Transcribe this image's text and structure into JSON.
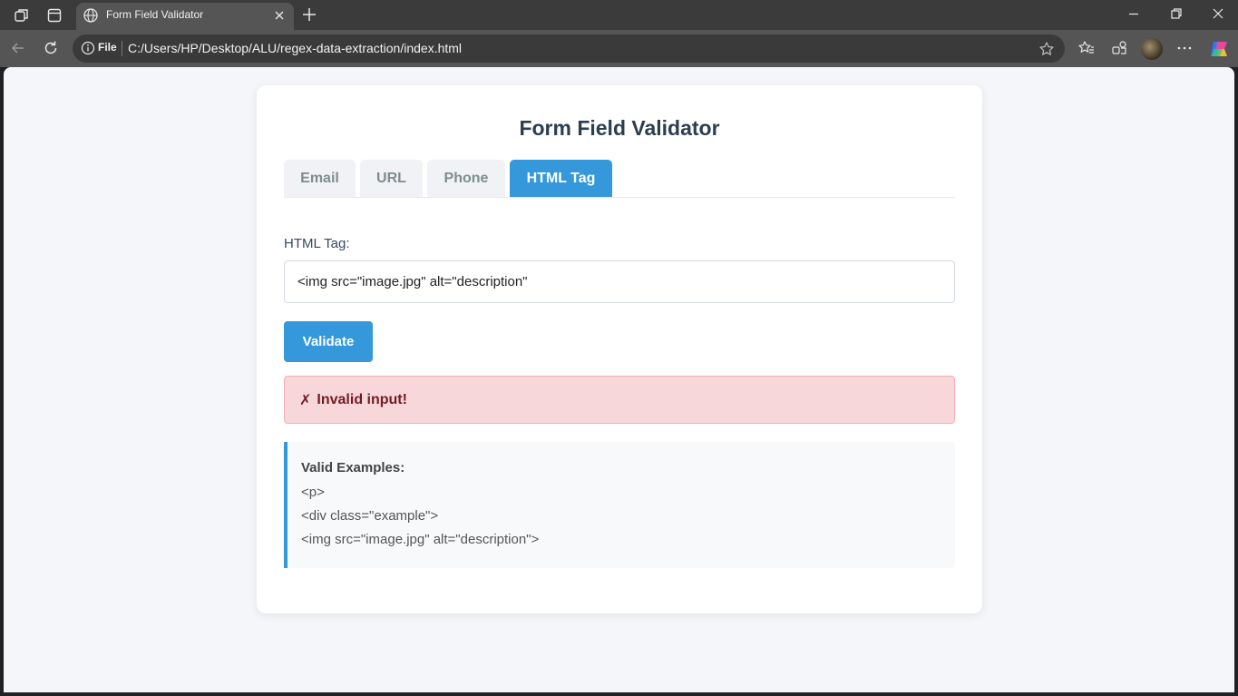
{
  "browser": {
    "tab_title": "Form Field Validator",
    "address_scheme_label": "File",
    "address_url": "C:/Users/HP/Desktop/ALU/regex-data-extraction/index.html"
  },
  "page": {
    "title": "Form Field Validator",
    "tabs": [
      {
        "label": "Email",
        "active": false
      },
      {
        "label": "URL",
        "active": false
      },
      {
        "label": "Phone",
        "active": false
      },
      {
        "label": "HTML Tag",
        "active": true
      }
    ],
    "field_label": "HTML Tag:",
    "field_value": "<img src=\"image.jpg\" alt=\"description\"",
    "validate_label": "Validate",
    "result": {
      "icon": "✗",
      "text": "Invalid input!",
      "status": "error"
    },
    "examples": {
      "title": "Valid Examples:",
      "items": [
        "<p>",
        "<div class=\"example\">",
        "<img src=\"image.jpg\" alt=\"description\">"
      ]
    }
  },
  "colors": {
    "accent": "#3498db",
    "title": "#2c3e50",
    "error_bg": "#f8d7da",
    "error_text": "#721c24"
  }
}
